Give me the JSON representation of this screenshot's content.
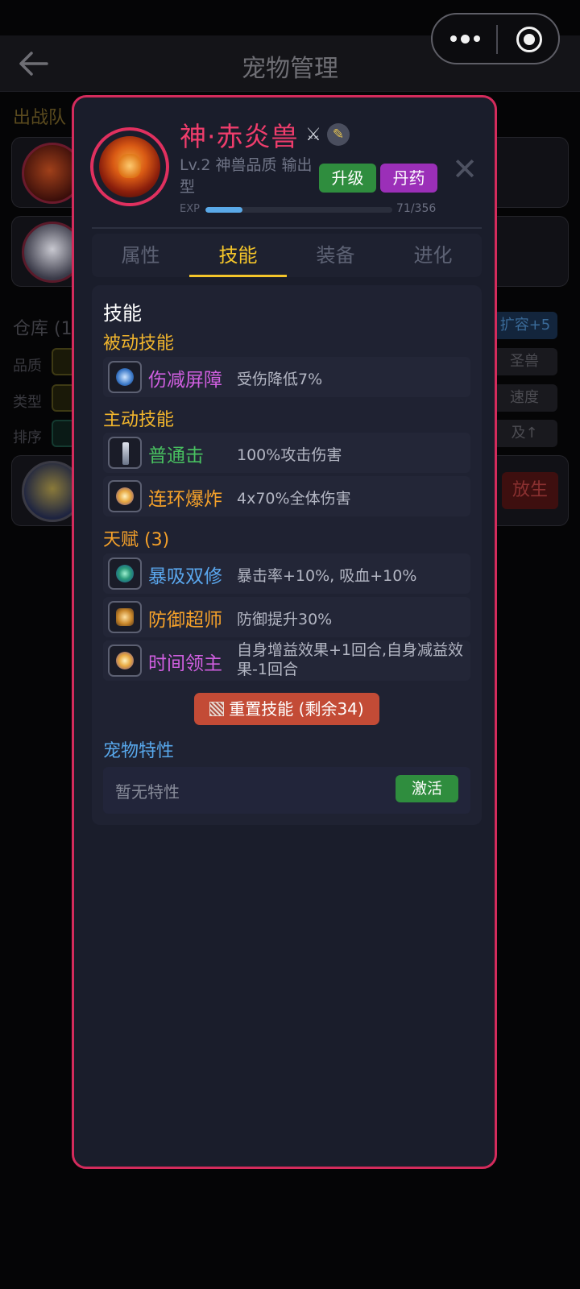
{
  "header": {
    "title": "宠物管理"
  },
  "background": {
    "team_title": "出战队",
    "storage_title": "仓库 (1",
    "expand_label": "扩容+5",
    "filter_labels": [
      "品质",
      "类型",
      "排序"
    ],
    "filter_right": [
      "圣兽",
      "速度",
      "及↑"
    ],
    "release_label": "放生"
  },
  "pet": {
    "name": "神·赤炎兽",
    "meta": "Lv.2  神兽品质  输出型",
    "upgrade_label": "升级",
    "pill_label": "丹药",
    "exp_label": "EXP",
    "exp_value": "71/356",
    "exp_current": 71,
    "exp_max": 356
  },
  "tabs": [
    {
      "label": "属性",
      "active": false
    },
    {
      "label": "技能",
      "active": true
    },
    {
      "label": "装备",
      "active": false
    },
    {
      "label": "进化",
      "active": false
    }
  ],
  "skills": {
    "title": "技能",
    "passive_title": "被动技能",
    "passive": [
      {
        "name": "伤减屏障",
        "desc": "受伤降低7%",
        "color": "#d05fe0",
        "icon": "shield-icon"
      }
    ],
    "active_title": "主动技能",
    "active": [
      {
        "name": "普通击",
        "desc": "100%攻击伤害",
        "color": "#48c060",
        "icon": "sword-icon"
      },
      {
        "name": "连环爆炸",
        "desc": "4x70%全体伤害",
        "color": "#f5a12a",
        "icon": "explosion-icon"
      }
    ],
    "talent_title": "天赋 (3)",
    "talents": [
      {
        "name": "暴吸双修",
        "desc": "暴击率+10%, 吸血+10%",
        "color": "#5aa7ee",
        "icon": "orb-icon"
      },
      {
        "name": "防御超师",
        "desc": "防御提升30%",
        "color": "#f5a12a",
        "icon": "armor-icon"
      },
      {
        "name": "时间领主",
        "desc": "自身增益效果+1回合,自身减益效果-1回合",
        "color": "#d05fe0",
        "icon": "clock-icon"
      }
    ],
    "reset_label": "重置技能 (剩余34)"
  },
  "traits": {
    "title": "宠物特性",
    "empty_text": "暂无特性",
    "activate_label": "激活"
  }
}
